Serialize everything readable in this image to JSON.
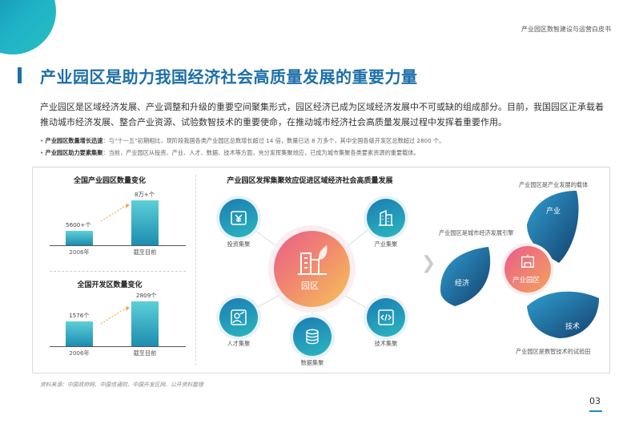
{
  "header": {
    "report_title": "产业园区数智建设与运营白皮书"
  },
  "page_title": "产业园区是助力我国经济社会高质量发展的重要力量",
  "intro": "产业园区是区域经济发展、产业调整和升级的重要空间聚集形式，园区经济已成为区域经济发展中不可或缺的组成部分。目前，我国园区正承载着推动城市经济发展、整合产业资源、试验数智技术的重要使命，在推动城市经济社会高质量发展过程中发挥着重要作用。",
  "bullets": [
    {
      "label": "产业园区数量增长迅速",
      "text": "：与“十一五”初期相比，现阶段我国各类产业园区总数增长超过 14 倍，数量已达 8 万多个，其中全国各级开发区总数超过 2800 个。"
    },
    {
      "label": "产业园区助力要素集聚",
      "text": "：当前，产业园区从投资、产业、人才、数据、技术等方面，充分发挥集聚效应，已成为城市集聚各类要素资源的重要载体。"
    }
  ],
  "chart_data": [
    {
      "type": "bar",
      "title": "全国产业园区数量变化",
      "categories": [
        "2006年",
        "截至目前"
      ],
      "values": [
        5600,
        80000
      ],
      "value_labels": [
        "5600+个",
        "8万+个"
      ]
    },
    {
      "type": "bar",
      "title": "全国开发区数量变化",
      "categories": [
        "2006年",
        "截至目前"
      ],
      "values": [
        1576,
        2809
      ],
      "value_labels": [
        "1576个",
        "2809个"
      ]
    }
  ],
  "diagram": {
    "title": "产业园区发挥集聚效应促进区域经济社会高质量发展",
    "hub": "园区",
    "nodes": [
      "投资集聚",
      "产业集聚",
      "人才集聚",
      "技术集聚",
      "数据集聚"
    ]
  },
  "roles": {
    "center": "产业园区",
    "leaves": [
      "产业",
      "经济",
      "技术"
    ],
    "captions": [
      "产业园区是产业发展的载体",
      "产业园区是城市经济发展引擎",
      "产业园区是数智技术的试验田"
    ]
  },
  "source": "资料来源：中国政府网、中国信通院、中国开发区网、公开资料整理",
  "page_number": "03"
}
